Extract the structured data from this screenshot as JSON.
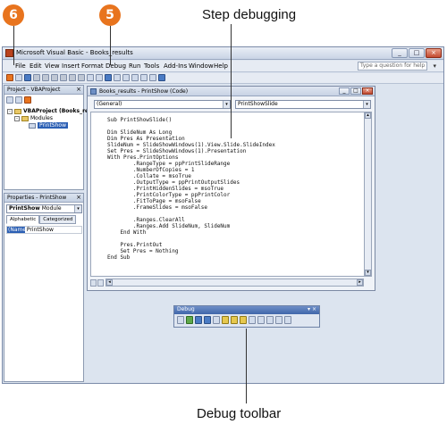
{
  "callouts": {
    "badge_left": "6",
    "badge_right": "5",
    "step_debugging": "Step debugging",
    "debug_toolbar": "Debug toolbar"
  },
  "window": {
    "title": "Microsoft Visual Basic - Books_results"
  },
  "menu": {
    "items": [
      "File",
      "Edit",
      "View",
      "Insert",
      "Format",
      "Debug",
      "Run",
      "Tools",
      "Add-Ins",
      "Window",
      "Help"
    ],
    "help_placeholder": "Type a question for help"
  },
  "project_panel": {
    "title": "Project - VBAProject",
    "root": "VBAProject (Books_resu",
    "modules": "Modules",
    "module": "PrintShow"
  },
  "properties_panel": {
    "title": "Properties - PrintShow",
    "combo_name": "PrintShow",
    "combo_type": "Module",
    "tab_alpha": "Alphabetic",
    "tab_cat": "Categorized",
    "prop_name": "(Name)",
    "prop_value": "PrintShow"
  },
  "code_window": {
    "title": "Books_results - PrintShow (Code)",
    "object_combo": "(General)",
    "proc_combo": "PrintShowSlide",
    "lines": [
      "Sub PrintShowSlide()",
      "",
      "Dim SlideNum As Long",
      "Dim Pres As Presentation",
      "SlideNum = SlideShowWindows(1).View.Slide.SlideIndex",
      "Set Pres = SlideShowWindows(1).Presentation",
      "With Pres.PrintOptions",
      "        .RangeType = ppPrintSlideRange",
      "        .NumberOfCopies = 1",
      "        .Collate = msoTrue",
      "        .OutputType = ppPrintOutputSlides",
      "        .PrintHiddenSlides = msoTrue",
      "        .PrintColorType = ppPrintColor",
      "        .FitToPage = msoFalse",
      "        .FrameSlides = msoFalse",
      "",
      "        .Ranges.ClearAll",
      "        .Ranges.Add SlideNum, SlideNum",
      "    End With",
      "",
      "    Pres.PrintOut",
      "    Set Pres = Nothing",
      "End Sub"
    ]
  },
  "debug_toolbar": {
    "title": "Debug"
  }
}
